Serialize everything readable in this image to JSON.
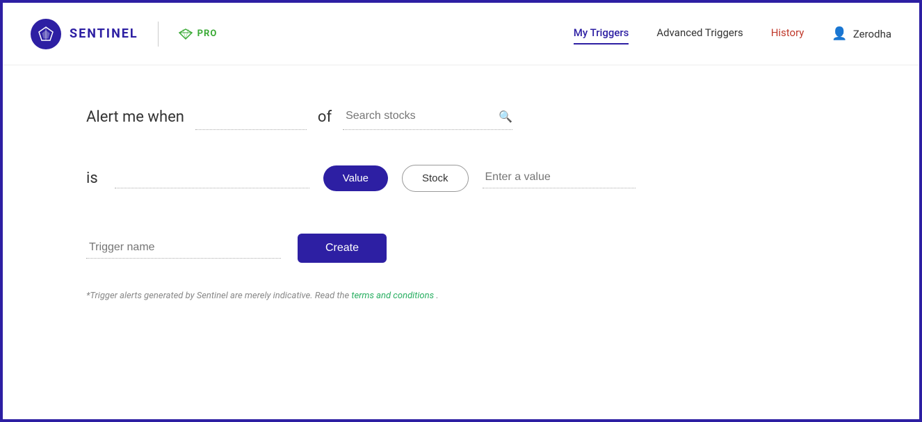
{
  "navbar": {
    "logo_text": "SENTINEL",
    "pro_text": "PRO",
    "links": [
      {
        "label": "My Triggers",
        "id": "my-triggers",
        "active": true,
        "color": "navy"
      },
      {
        "label": "Advanced Triggers",
        "id": "advanced-triggers",
        "active": false,
        "color": "default"
      },
      {
        "label": "History",
        "id": "history",
        "active": false,
        "color": "red"
      },
      {
        "label": "Zerodha",
        "id": "zerodha",
        "active": false,
        "color": "default"
      }
    ]
  },
  "main": {
    "alert_label": "Alert me when",
    "of_label": "of",
    "condition_placeholder": "",
    "search_stocks_placeholder": "Search stocks",
    "is_label": "is",
    "value_button_label": "Value",
    "stock_button_label": "Stock",
    "enter_value_placeholder": "Enter a value",
    "trigger_name_placeholder": "Trigger name",
    "create_button_label": "Create",
    "footer_note_prefix": "*Trigger alerts generated by Sentinel are merely indicative. Read the",
    "footer_link_text": "terms and conditions",
    "footer_note_suffix": "."
  }
}
